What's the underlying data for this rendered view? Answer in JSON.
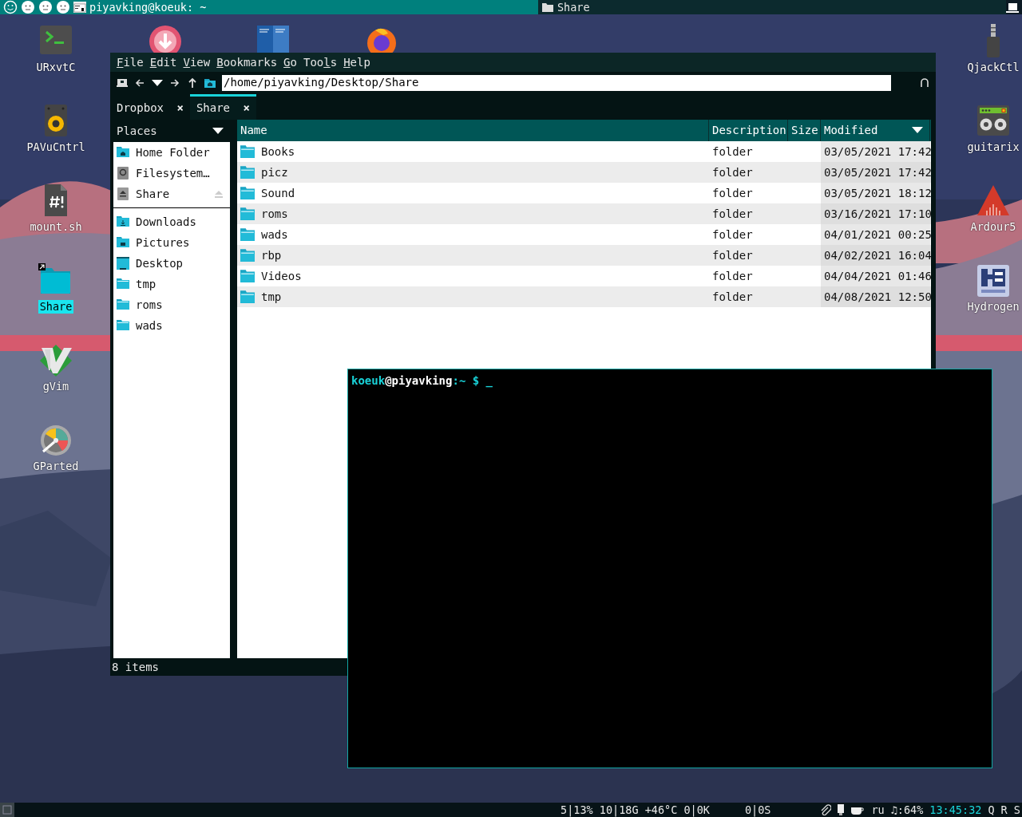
{
  "top_panel": {
    "workspaces": [
      {
        "selected": true
      },
      {
        "selected": false
      },
      {
        "selected": false
      },
      {
        "selected": false
      }
    ],
    "active_window": {
      "title": "piyavking@koeuk: ~"
    },
    "other_window": {
      "title": "Share"
    }
  },
  "desktop_icons_left": [
    {
      "label": "URxvtC",
      "kind": "terminal",
      "selected": false
    },
    {
      "label": "PAVuCntrl",
      "kind": "speaker",
      "selected": false
    },
    {
      "label": "mount.sh",
      "kind": "script",
      "selected": false
    },
    {
      "label": "Share",
      "kind": "folder-link",
      "selected": true
    },
    {
      "label": "gVim",
      "kind": "editor",
      "selected": false
    },
    {
      "label": "GParted",
      "kind": "disk",
      "selected": false
    }
  ],
  "desktop_icons_right": [
    {
      "label": "QjackCtl",
      "kind": "plug",
      "selected": false
    },
    {
      "label": "guitarix",
      "kind": "amp",
      "selected": false
    },
    {
      "label": "Ardour5",
      "kind": "daw",
      "selected": false
    },
    {
      "label": "Hydrogen",
      "kind": "drum",
      "selected": false
    }
  ],
  "partly_hidden_icons": [
    {
      "kind": "download"
    },
    {
      "kind": "books"
    },
    {
      "kind": "browser"
    }
  ],
  "file_manager": {
    "menu": [
      {
        "mnemonic": "F",
        "rest": "ile"
      },
      {
        "mnemonic": "E",
        "rest": "dit"
      },
      {
        "mnemonic": "V",
        "rest": "iew"
      },
      {
        "mnemonic": "B",
        "rest": "ookmarks"
      },
      {
        "mnemonic": "G",
        "rest": "o"
      },
      {
        "start": "Too",
        "mnemonic": "l",
        "rest": "s"
      },
      {
        "mnemonic": "H",
        "rest": "elp"
      }
    ],
    "path": "/home/piyavking/Desktop/Share",
    "tabs": [
      {
        "label": "Dropbox",
        "close": "×",
        "selected": false
      },
      {
        "label": "Share",
        "close": "×",
        "selected": true
      }
    ],
    "sidebar": {
      "title": "Places",
      "sections": [
        {
          "items": [
            {
              "label": "Home Folder",
              "kind": "home"
            },
            {
              "label": "Filesystem…",
              "kind": "drive"
            },
            {
              "label": "Share",
              "kind": "removable"
            }
          ]
        },
        {
          "items": [
            {
              "label": "Downloads",
              "kind": "downloads"
            },
            {
              "label": "Pictures",
              "kind": "pictures"
            },
            {
              "label": "Desktop",
              "kind": "desktop"
            },
            {
              "label": "tmp",
              "kind": "folder"
            },
            {
              "label": "roms",
              "kind": "folder"
            },
            {
              "label": "wads",
              "kind": "folder"
            }
          ]
        }
      ]
    },
    "columns": [
      {
        "label": "Name",
        "sorted": false
      },
      {
        "label": "Description",
        "sorted": false
      },
      {
        "label": "Size",
        "sorted": false
      },
      {
        "label": "Modified",
        "sorted": true
      }
    ],
    "rows": [
      {
        "name": "Books",
        "description": "folder",
        "modified": "03/05/2021 17:42"
      },
      {
        "name": "picz",
        "description": "folder",
        "modified": "03/05/2021 17:42"
      },
      {
        "name": "Sound",
        "description": "folder",
        "modified": "03/05/2021 18:12"
      },
      {
        "name": "roms",
        "description": "folder",
        "modified": "03/16/2021 17:10"
      },
      {
        "name": "wads",
        "description": "folder",
        "modified": "04/01/2021 00:25"
      },
      {
        "name": "rbp",
        "description": "folder",
        "modified": "04/02/2021 16:04"
      },
      {
        "name": "Videos",
        "description": "folder",
        "modified": "04/04/2021 01:46"
      },
      {
        "name": "tmp",
        "description": "folder",
        "modified": "04/08/2021 12:50"
      }
    ],
    "status": "8 items"
  },
  "terminal": {
    "user": "koeuk",
    "host": "@piyavking",
    "path": ":~",
    "prompt": "$",
    "cursor": "_"
  },
  "bottom_panel": {
    "stats": [
      "5|13%",
      "10|18G",
      "+46°C",
      "0|0K"
    ],
    "swap": "0|0S",
    "layout": "ru",
    "volume": "♫:64%",
    "clock": "13:45:32",
    "buttons": [
      "Q",
      "R",
      "S"
    ]
  }
}
